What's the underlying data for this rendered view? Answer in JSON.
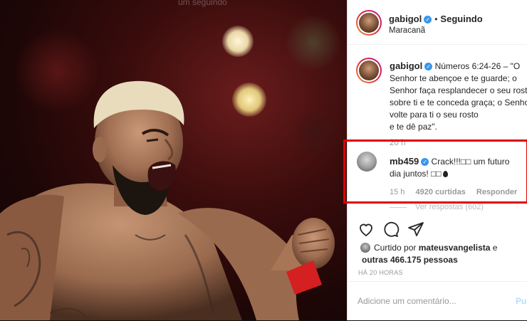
{
  "post": {
    "username": "gabigol",
    "separator": "•",
    "follow_label": "Seguindo",
    "location": "Maracanã",
    "caption_lines": [
      "Números 6:24-26 – \"O",
      "Senhor te abençoe e te guarde; o",
      "Senhor faça resplandecer o seu rosto",
      "sobre ti e te conceda graça; o Senho",
      "volte para ti o seu rosto",
      "e te dê paz\"."
    ],
    "caption_time": "20 h",
    "top_overlay_text": "um seguindo"
  },
  "comment": {
    "username": "mb459",
    "text_line1": "Crack!!!□□ um futuro",
    "text_line2": "dia juntos! □□",
    "time": "15 h",
    "likes": "4920 curtidas",
    "reply_label": "Responder",
    "view_replies": "Ver respostas (602)",
    "highlight_color": "#e00000"
  },
  "likes": {
    "prefix": "Curtido por",
    "user": "mateusvangelista",
    "connector": " e",
    "others": "outras 466.175 pessoas",
    "time_ago": "HÁ 20 HORAS"
  },
  "compose": {
    "placeholder": "Adicione um comentário...",
    "publish_label": "Pul"
  },
  "icons": [
    "heart-icon",
    "comment-icon",
    "share-icon",
    "verified-badge-icon",
    "fire-drop-icon"
  ],
  "colors": {
    "verified_blue": "#3897f0",
    "text": "#262626",
    "muted": "#999999",
    "publish_disabled": "#b2dffc"
  }
}
